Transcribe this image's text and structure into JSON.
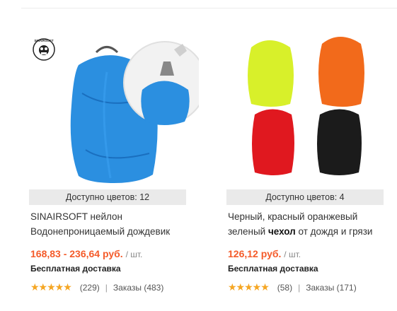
{
  "products": [
    {
      "brand_logo": "SINAIRSOFT",
      "colors_available": "Доступно цветов: 12",
      "title": "SINAIRSOFT нейлон Водонепроницаемый дождевик",
      "price": "168,83 - 236,64 руб.",
      "price_unit": "/ шт.",
      "shipping": "Бесплатная доставка",
      "rating_stars": 5,
      "reviews": "(229)",
      "orders": "Заказы (483)",
      "image_colors": {
        "cover": "#2b8fe0",
        "cover_dark": "#1a6fbf"
      }
    },
    {
      "colors_available": "Доступно цветов: 4",
      "title_part1": "Черный, красный оранжевый зеленый ",
      "title_bold": "чехол",
      "title_part2": " от дождя и грязи",
      "price": "126,12 руб.",
      "price_unit": "/ шт.",
      "shipping": "Бесплатная доставка",
      "rating_stars": 5,
      "reviews": "(58)",
      "orders": "Заказы (171)",
      "image_colors": {
        "yellow": "#d8f02a",
        "orange": "#f26a1b",
        "red": "#e0181f",
        "black": "#1b1b1b"
      }
    }
  ],
  "icons": {
    "star": "star-icon"
  }
}
